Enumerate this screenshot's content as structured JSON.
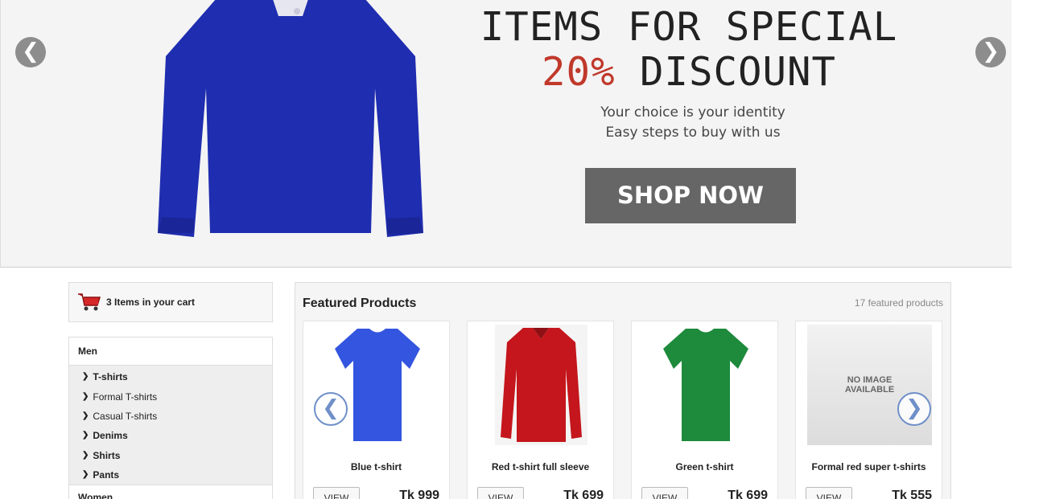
{
  "hero": {
    "title_line1": "ITEMS FOR SPECIAL",
    "discount_pct": "20%",
    "discount_word": "DISCOUNT",
    "tagline1": "Your choice is your identity",
    "tagline2": "Easy steps to buy with us",
    "cta": "SHOP NOW",
    "prev": "❮",
    "next": "❯",
    "shirt_color": "#1f2db0"
  },
  "cart": {
    "text": "3 Items in your cart"
  },
  "categories": {
    "men": "Men",
    "items": [
      "T-shirts",
      "Formal T-shirts",
      "Casual T-shirts",
      "Denims",
      "Shirts",
      "Pants"
    ],
    "women": "Women"
  },
  "featured": {
    "title": "Featured Products",
    "count": "17 featured products",
    "view_label": "VIEW",
    "products": [
      {
        "name": "Blue t-shirt",
        "price": "Tk 999",
        "color": "#3355e0"
      },
      {
        "name": "Red t-shirt full sleeve",
        "price": "Tk 699",
        "color": "#c4161c"
      },
      {
        "name": "Green t-shirt",
        "price": "Tk 699",
        "color": "#1e8a3c"
      },
      {
        "name": "Formal red super t-shirts",
        "price": "Tk 555",
        "image_text_1": "NO IMAGE",
        "image_text_2": "AVAILABLE"
      }
    ],
    "prev": "❮",
    "next": "❯"
  }
}
